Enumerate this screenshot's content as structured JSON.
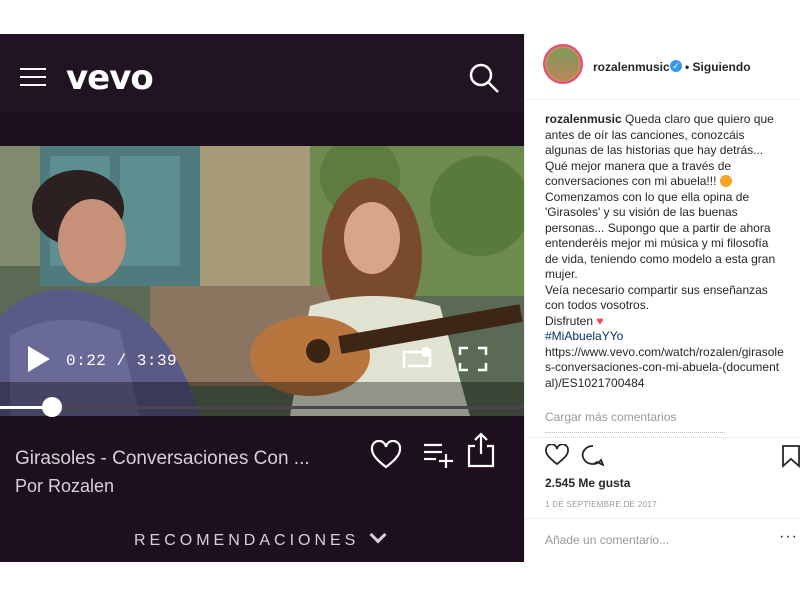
{
  "vevo": {
    "logo": "vevo",
    "icons": {
      "menu": "hamburger-icon",
      "search": "search-icon",
      "play": "play-icon",
      "replay": "replay-icon",
      "fullscreen": "fullscreen-icon",
      "like": "heart-icon",
      "add_to_playlist": "playlist-add-icon",
      "share": "share-icon"
    },
    "player": {
      "current_time": "0:22",
      "separator": "/",
      "duration": "3:39",
      "progress_fraction": 0.1
    },
    "video_title": "Girasoles - Conversaciones Con ...",
    "artist": "Por Rozalen",
    "recommendations": "RECOMENDACIONES"
  },
  "instagram": {
    "username": "rozalenmusic",
    "verified": true,
    "follow_status": "• Siguiendo",
    "caption": {
      "user": "rozalenmusic",
      "lines": [
        " Queda claro que quiero que antes de oír las canciones, conozcáis algunas de las historias que hay detrás... Qué mejor manera que a través de conversaciones con mi abuela!!! ",
        "Comenzamos con lo que ella opina de 'Girasoles' y su visión de las buenas personas... Supongo que a partir de ahora entenderéis mejor mi música y mi filosofía de vida, teniendo como modelo a esta gran mujer.",
        "Veía necesario compartir sus enseñanzas con todos vosotros.",
        "Disfruten "
      ],
      "hashtag": "#MiAbuelaYYo",
      "link": "https://www.vevo.com/watch/rozalen/girasoles-conversaciones-con-mi-abuela-(documental)/ES1021700484"
    },
    "more_comments": "Cargar más comentarios",
    "likes": "2.545 Me gusta",
    "date": "1 DE SEPTIEMBRE DE 2017",
    "comment_placeholder": "Añade un comentario...",
    "options": "···",
    "colors": {
      "accent": "#3897f0",
      "heart": "#ed4956",
      "vevo_bg": "#1d0f1e"
    }
  }
}
